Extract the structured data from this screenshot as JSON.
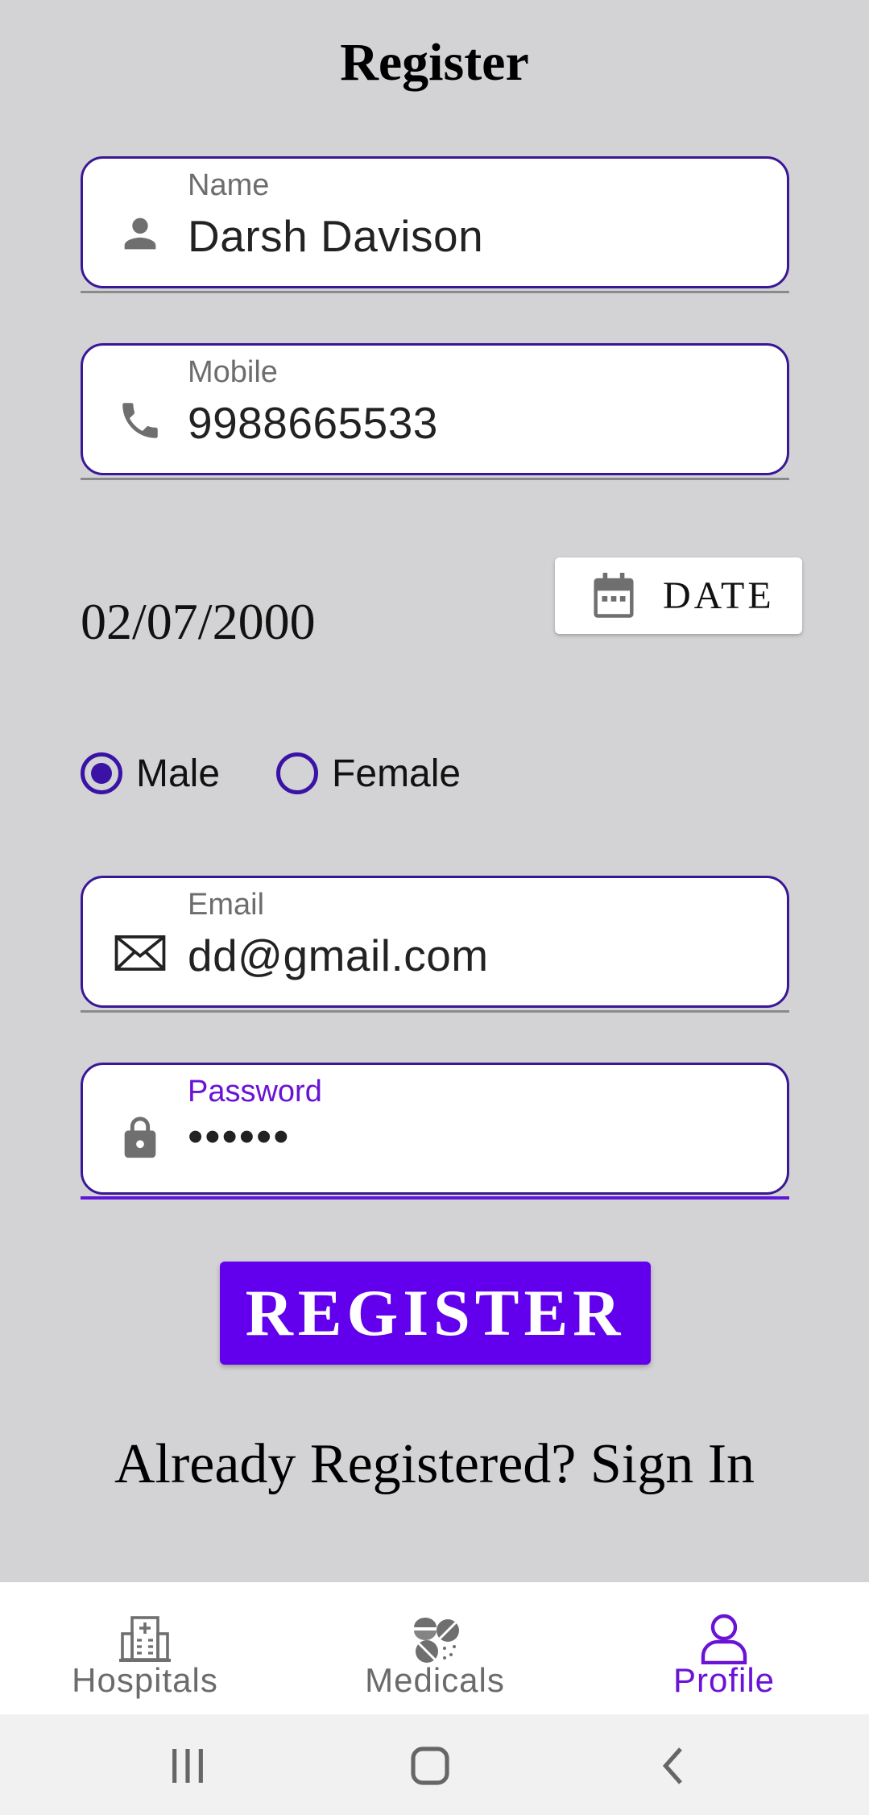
{
  "page_title": "Register",
  "fields": {
    "name": {
      "label": "Name",
      "value": "Darsh Davison",
      "icon": "person-icon"
    },
    "mobile": {
      "label": "Mobile",
      "value": "9988665533",
      "icon": "phone-icon"
    },
    "email": {
      "label": "Email",
      "value": "dd@gmail.com",
      "icon": "envelope-icon"
    },
    "password": {
      "label": "Password",
      "value": "••••••",
      "icon": "lock-icon"
    }
  },
  "dob": {
    "value": "02/07/2000",
    "button_label": "DATE",
    "icon": "calendar-icon"
  },
  "gender": {
    "options": [
      "Male",
      "Female"
    ],
    "selected": "Male"
  },
  "register_button": "REGISTER",
  "signin_text": "Already Registered? Sign In",
  "bottom_nav": {
    "items": [
      {
        "label": "Hospitals",
        "icon": "hospital-icon",
        "active": false
      },
      {
        "label": "Medicals",
        "icon": "pills-icon",
        "active": false
      },
      {
        "label": "Profile",
        "icon": "profile-icon",
        "active": true
      }
    ]
  },
  "colors": {
    "background": "#d3d3d5",
    "accent": "#6200ee",
    "field_border": "#3a1796",
    "active_label": "#6a13d6"
  }
}
